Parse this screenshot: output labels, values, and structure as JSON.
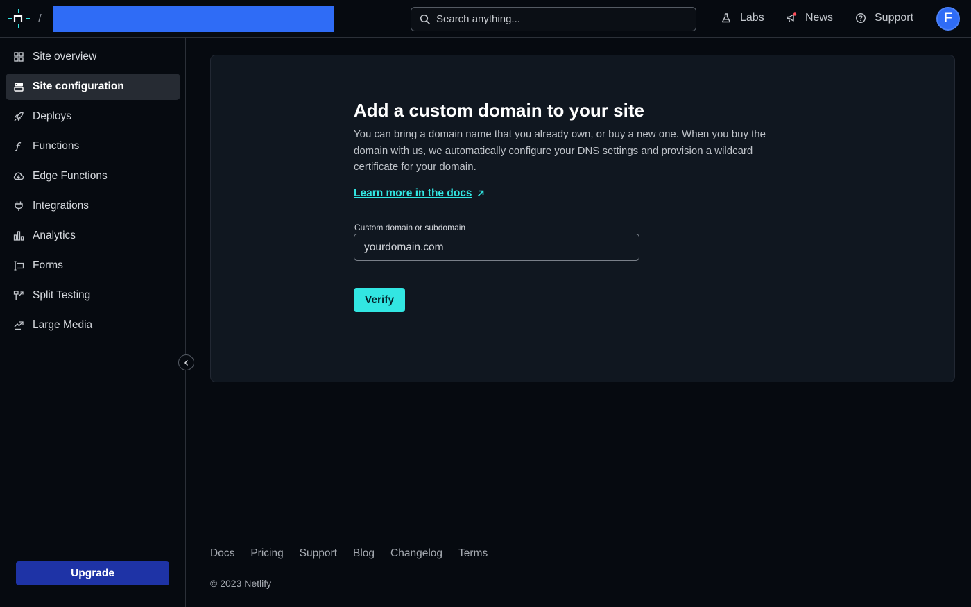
{
  "header": {
    "separator": "/",
    "search": {
      "placeholder": "Search anything..."
    },
    "nav": {
      "labs": "Labs",
      "news": "News",
      "support": "Support"
    },
    "avatar_initial": "F"
  },
  "sidebar": {
    "items": [
      {
        "label": "Site overview",
        "icon": "grid-icon"
      },
      {
        "label": "Site configuration",
        "icon": "server-icon",
        "active": true
      },
      {
        "label": "Deploys",
        "icon": "rocket-icon"
      },
      {
        "label": "Functions",
        "icon": "function-icon"
      },
      {
        "label": "Edge Functions",
        "icon": "cloud-icon"
      },
      {
        "label": "Integrations",
        "icon": "plug-icon"
      },
      {
        "label": "Analytics",
        "icon": "bar-chart-icon"
      },
      {
        "label": "Forms",
        "icon": "form-icon"
      },
      {
        "label": "Split Testing",
        "icon": "split-icon"
      },
      {
        "label": "Large Media",
        "icon": "media-icon"
      }
    ],
    "upgrade_label": "Upgrade"
  },
  "main": {
    "title": "Add a custom domain to your site",
    "description": "You can bring a domain name that you already own, or buy a new one. When you buy the domain with us, we automatically configure your DNS settings and provision a wildcard certificate for your domain.",
    "learn_more": "Learn more in the docs",
    "field_label": "Custom domain or subdomain",
    "field_placeholder": "yourdomain.com",
    "verify_label": "Verify"
  },
  "footer": {
    "links": [
      "Docs",
      "Pricing",
      "Support",
      "Blog",
      "Changelog",
      "Terms"
    ],
    "copyright": "© 2023 Netlify"
  },
  "colors": {
    "accent": "#32e6e2",
    "brand_blue": "#2f6cf6",
    "upgrade": "#1e33a6",
    "background": "#060a10",
    "card": "#101720",
    "news_dot": "#ff4d5a"
  }
}
